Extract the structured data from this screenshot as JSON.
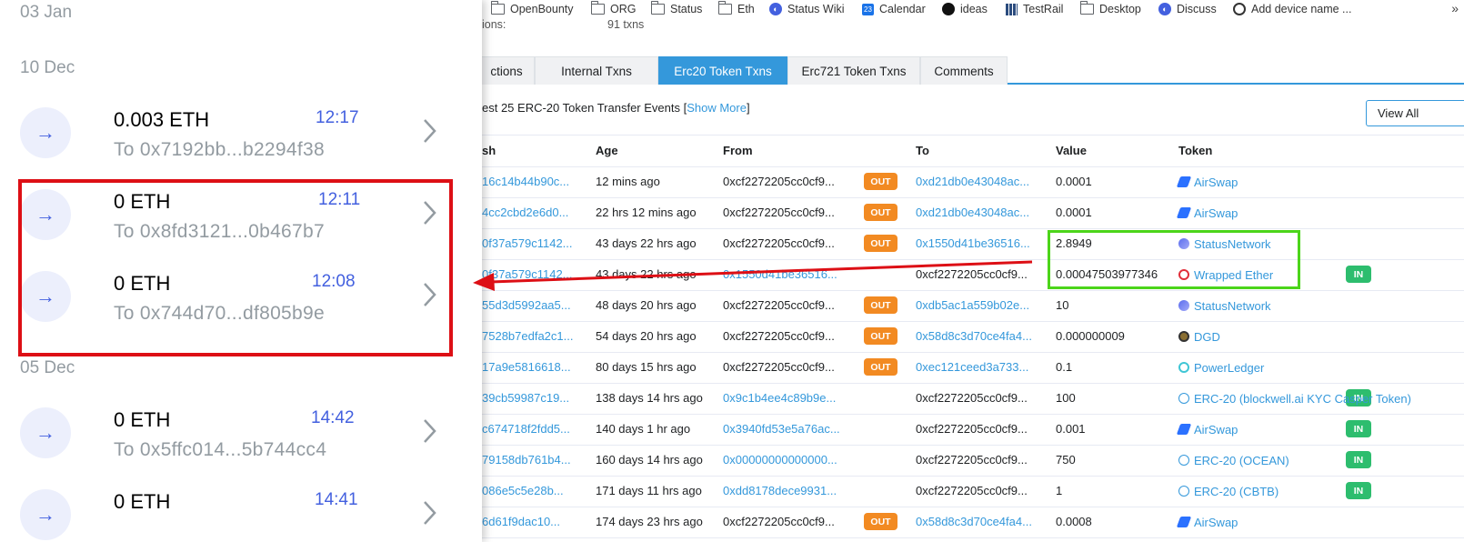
{
  "bookmarks": [
    {
      "label": "OpenBounty",
      "icon": "folder-icon"
    },
    {
      "label": "ORG",
      "icon": "folder-icon"
    },
    {
      "label": "Status",
      "icon": "folder-icon"
    },
    {
      "label": "Eth",
      "icon": "folder-icon"
    },
    {
      "label": "Status Wiki",
      "icon": "status-icon"
    },
    {
      "label": "Calendar",
      "icon": "calendar-icon",
      "badge": "23"
    },
    {
      "label": "ideas",
      "icon": "github-icon"
    },
    {
      "label": "TestRail",
      "icon": "testrail-icon"
    },
    {
      "label": "Desktop",
      "icon": "folder-icon"
    },
    {
      "label": "Discuss",
      "icon": "discuss-icon"
    },
    {
      "label": "Add device name ...",
      "icon": "app-icon"
    }
  ],
  "bookmarks_more": "»",
  "partial_top": {
    "label": "ions:",
    "count": "91 txns"
  },
  "tabs": [
    "ctions",
    "Internal Txns",
    "Erc20 Token Txns",
    "Erc721 Token Txns",
    "Comments"
  ],
  "active_tab": "Erc20 Token Txns",
  "notice": {
    "prefix": "est 25 ERC-20 Token Transfer Events [",
    "link": "Show More",
    "suffix": "]"
  },
  "view_all_label": "View All",
  "table": {
    "headers": [
      "sh",
      "Age",
      "From",
      "To",
      "Value",
      "Token"
    ],
    "rows": [
      {
        "hash": "16c14b44b90c...",
        "age": "12 mins ago",
        "from": "0xcf2272205cc0cf9...",
        "dir": "OUT",
        "to": "0xd21db0e43048ac...",
        "value": "0.0001",
        "token": "AirSwap",
        "token_icon": "airswap-icon"
      },
      {
        "hash": "4cc2cbd2e6d0...",
        "age": "22 hrs 12 mins ago",
        "from": "0xcf2272205cc0cf9...",
        "dir": "OUT",
        "to": "0xd21db0e43048ac...",
        "value": "0.0001",
        "token": "AirSwap",
        "token_icon": "airswap-icon"
      },
      {
        "hash": "0f37a579c1142...",
        "age": "43 days 22 hrs ago",
        "from": "0xcf2272205cc0cf9...",
        "dir": "OUT",
        "to": "0x1550d41be36516...",
        "value": "2.8949",
        "token": "StatusNetwork",
        "token_icon": "statusnetwork-icon"
      },
      {
        "hash": "0f37a579c1142...",
        "age": "43 days 22 hrs ago",
        "from": "0x1550d41be36516...",
        "dir": "IN",
        "to": "0xcf2272205cc0cf9...",
        "value": "0.00047503977346",
        "token": "Wrapped Ether",
        "token_icon": "wrapped-ether-icon"
      },
      {
        "hash": "55d3d5992aa5...",
        "age": "48 days 20 hrs ago",
        "from": "0xcf2272205cc0cf9...",
        "dir": "OUT",
        "to": "0xdb5ac1a559b02e...",
        "value": "10",
        "token": "StatusNetwork",
        "token_icon": "statusnetwork-icon"
      },
      {
        "hash": "7528b7edfa2c1...",
        "age": "54 days 20 hrs ago",
        "from": "0xcf2272205cc0cf9...",
        "dir": "OUT",
        "to": "0x58d8c3d70ce4fa4...",
        "value": "0.000000009",
        "token": "DGD",
        "token_icon": "dgd-icon"
      },
      {
        "hash": "17a9e5816618...",
        "age": "80 days 15 hrs ago",
        "from": "0xcf2272205cc0cf9...",
        "dir": "OUT",
        "to": "0xec121ceed3a733...",
        "value": "0.1",
        "token": "PowerLedger",
        "token_icon": "powerledger-icon"
      },
      {
        "hash": "39cb59987c19...",
        "age": "138 days 14 hrs ago",
        "from": "0x9c1b4ee4c89b9e...",
        "dir": "IN",
        "to": "0xcf2272205cc0cf9...",
        "value": "100",
        "token": "ERC-20 (blockwell.ai KYC Casper Token)",
        "token_icon": "erc20-icon"
      },
      {
        "hash": "c674718f2fdd5...",
        "age": "140 days 1 hr ago",
        "from": "0x3940fd53e5a76ac...",
        "dir": "IN",
        "to": "0xcf2272205cc0cf9...",
        "value": "0.001",
        "token": "AirSwap",
        "token_icon": "airswap-icon"
      },
      {
        "hash": "79158db761b4...",
        "age": "160 days 14 hrs ago",
        "from": "0x00000000000000...",
        "dir": "IN",
        "to": "0xcf2272205cc0cf9...",
        "value": "750",
        "token": "ERC-20 (OCEAN)",
        "token_icon": "erc20-icon"
      },
      {
        "hash": "086e5c5e28b...",
        "age": "171 days 11 hrs ago",
        "from": "0xdd8178dece9931...",
        "dir": "IN",
        "to": "0xcf2272205cc0cf9...",
        "value": "1",
        "token": "ERC-20 (CBTB)",
        "token_icon": "erc20-icon"
      },
      {
        "hash": "6d61f9dac10...",
        "age": "174 days 23 hrs ago",
        "from": "0xcf2272205cc0cf9...",
        "dir": "OUT",
        "to": "0x58d8c3d70ce4fa4...",
        "value": "0.0008",
        "token": "AirSwap",
        "token_icon": "airswap-icon"
      }
    ]
  },
  "wallet": {
    "dates": [
      "03 Jan",
      "10 Dec",
      "05 Dec"
    ],
    "transactions": [
      {
        "amount": "0.003 ETH",
        "time": "12:17",
        "to": "To 0x7192bb...b2294f38"
      },
      {
        "amount": "0 ETH",
        "time": "12:11",
        "to": "To 0x8fd3121...0b467b7"
      },
      {
        "amount": "0 ETH",
        "time": "12:08",
        "to": "To 0x744d70...df805b9e"
      },
      {
        "amount": "0 ETH",
        "time": "14:42",
        "to": "To 0x5ffc014...5b744cc4"
      },
      {
        "amount": "0 ETH",
        "time": "14:41",
        "to": ""
      }
    ]
  },
  "colors": {
    "accent_blue": "#3498db",
    "wallet_blue": "#4360df",
    "out_badge": "#f28a22",
    "in_badge": "#2dbd6e",
    "highlight_red": "#dd0f15",
    "highlight_green": "#4cd51a"
  }
}
